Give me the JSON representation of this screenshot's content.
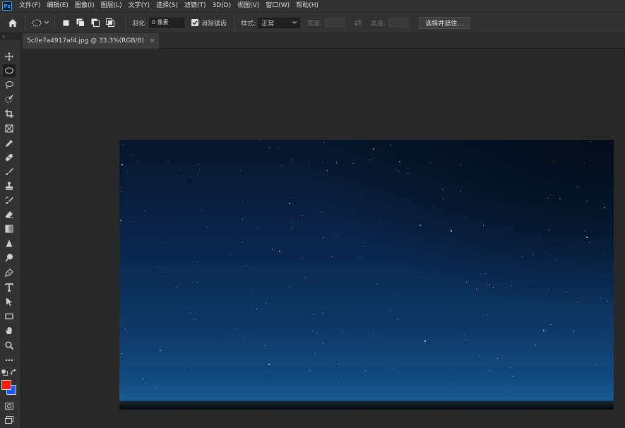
{
  "app": {
    "logo_text": "Ps",
    "menu": [
      "文件(F)",
      "编辑(E)",
      "图像(I)",
      "图层(L)",
      "文字(Y)",
      "选择(S)",
      "滤镜(T)",
      "3D(D)",
      "视图(V)",
      "窗口(W)",
      "帮助(H)"
    ]
  },
  "options": {
    "feather_label": "羽化:",
    "feather_value": "0 像素",
    "antialias_label": "消除锯齿",
    "antialias_checked": true,
    "style_label": "样式:",
    "style_value": "正常",
    "width_label": "宽度:",
    "height_label": "高度:",
    "select_mask_button": "选择并遮住..."
  },
  "document": {
    "tab_title": "5c0e7a4917af4.jpg @ 33.3%(RGB/8)",
    "close_symbol": "×"
  },
  "colors": {
    "foreground": "#ff1a0a",
    "background": "#1d57ff"
  },
  "tools": [
    "move-tool",
    "elliptical-marquee-tool",
    "lasso-tool",
    "quick-selection-tool",
    "crop-tool",
    "frame-tool",
    "eyedropper-tool",
    "healing-brush-tool",
    "brush-tool",
    "clone-stamp-tool",
    "history-brush-tool",
    "eraser-tool",
    "gradient-tool",
    "blur-tool",
    "dodge-tool",
    "pen-tool",
    "type-tool",
    "path-selection-tool",
    "rectangle-tool",
    "hand-tool",
    "zoom-tool",
    "edit-toolbar"
  ]
}
